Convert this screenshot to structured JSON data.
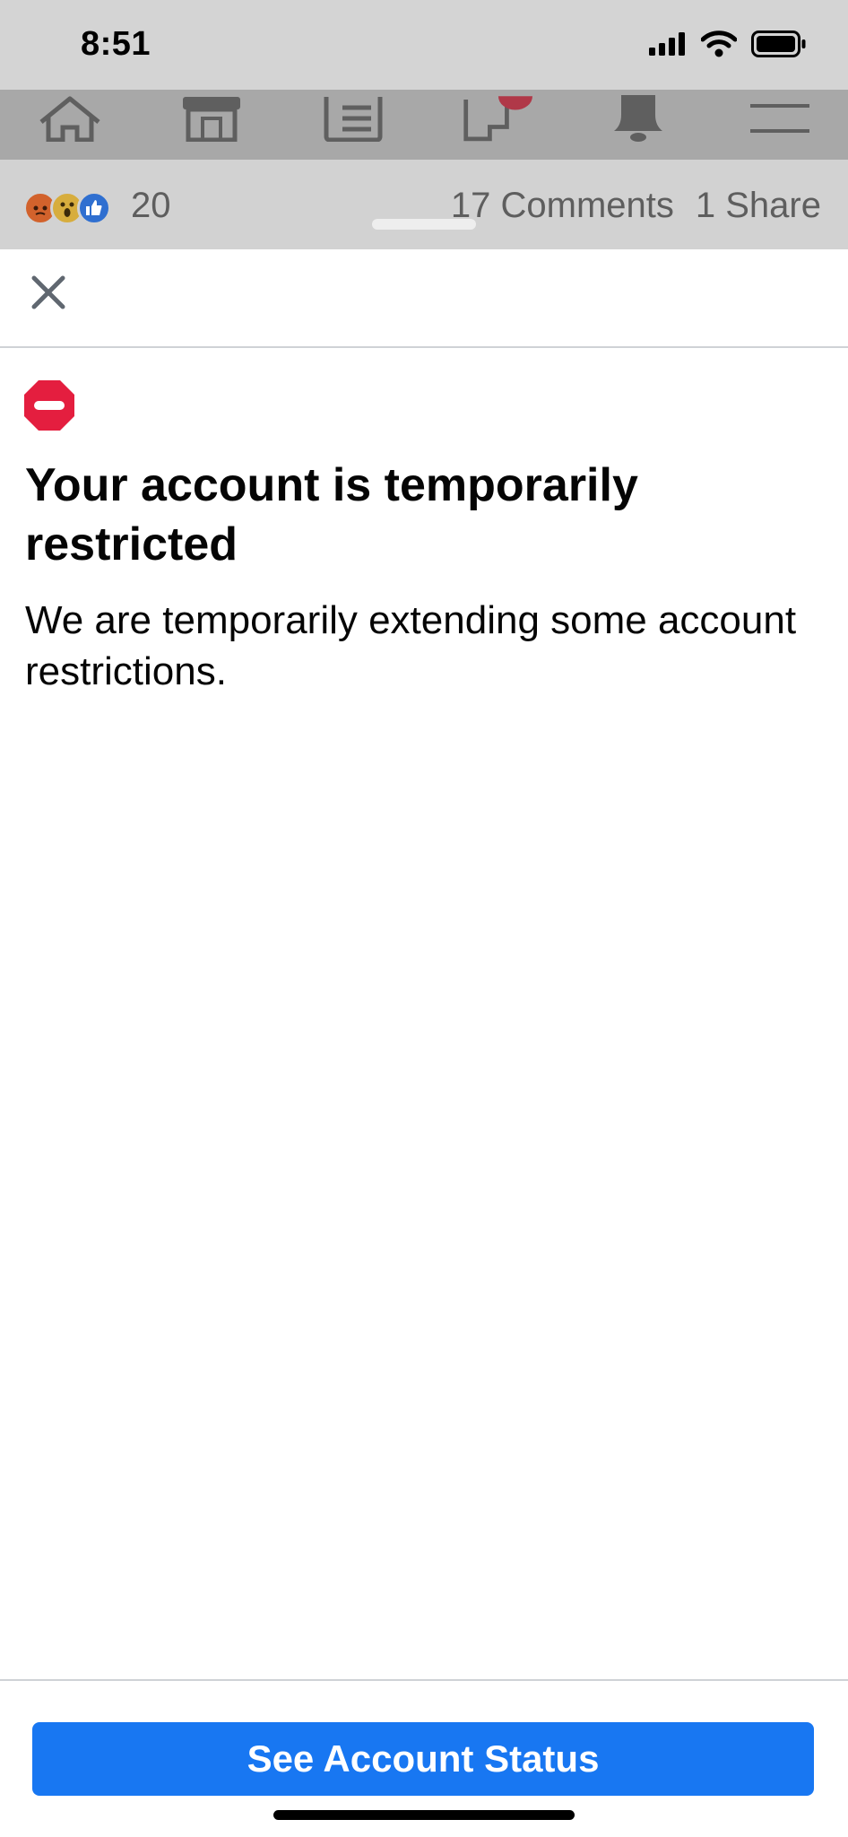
{
  "status_bar": {
    "time": "8:51",
    "icons": [
      "cellular-signal-icon",
      "wifi-icon",
      "battery-icon"
    ]
  },
  "background_nav": {
    "icons": [
      "home-icon",
      "marketplace-icon",
      "news-feed-icon",
      "pages-icon",
      "notifications-bell-icon",
      "menu-icon"
    ]
  },
  "post_footer": {
    "reactions": [
      "angry-reaction-icon",
      "wow-reaction-icon",
      "like-reaction-icon"
    ],
    "reaction_count": "20",
    "comments": "17 Comments",
    "shares": "1 Share"
  },
  "dialog": {
    "close_icon": "close-icon",
    "status_icon": "restricted-icon",
    "title": "Your account is temporarily restricted",
    "description": "We are temporarily extending some account restrictions.",
    "primary_button": "See Account Status"
  },
  "colors": {
    "accent": "#1877f2",
    "restricted_red": "#e41e3f",
    "dim_overlay": "#a8a8a8"
  }
}
